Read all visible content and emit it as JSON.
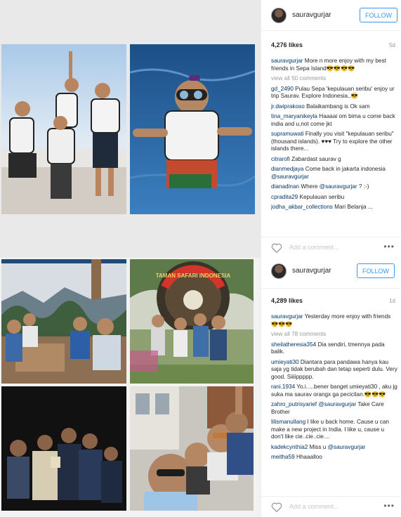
{
  "post1": {
    "username": "sauravgurjar",
    "follow_label": "FOLLOW",
    "likes": "4,276 likes",
    "age": "5d",
    "caption_user": "sauravgurjar",
    "caption_text": "More n more enjoy with my best friends in Sepa Island😎😎😎😎",
    "view_all": "view all 50 comments",
    "comments": [
      {
        "user": "gd_2490",
        "text": "Pulau Sepa 'kepulauan seribu' enjoy ur trip Saurav. Explore Indonesia..😎"
      },
      {
        "user": "jr.dwiprakoso",
        "text": "Balaikambang is Ok sam"
      },
      {
        "user": "tina_maryanikeyla",
        "text": "Haaaai om bima u come back india and u,not come jkt"
      },
      {
        "user": "supramuwati",
        "text": "Finally you visit \"kepulauan seribu\" (thousand islands). ♥♥♥ Try to explore the other islands there..."
      },
      {
        "user": "citrarofi",
        "text": "Zabardast saurav g"
      },
      {
        "user": "dianmedjaya",
        "text": "Come back in jakarta indonesia",
        "mention": "@sauravgurjar"
      },
      {
        "user": "dianadinan",
        "text": "Where",
        "mention": "@sauravgurjar",
        "suffix": "? :-)"
      },
      {
        "user": "cpradita29",
        "text": "Kepulauan seribu"
      },
      {
        "user": "jodha_akbar_collections",
        "text": "Mari Belanja ..."
      }
    ],
    "add_comment_placeholder": "Add a comment...",
    "more_label": "•••"
  },
  "post2": {
    "username": "sauravgurjar",
    "follow_label": "FOLLOW",
    "likes": "4,289 likes",
    "age": "1d",
    "caption_user": "sauravgurjar",
    "caption_text": "Yesterday more enjoy with friends 😎😎😎",
    "view_all": "view all 78 comments",
    "comments": [
      {
        "user": "sheilatheresia354",
        "text": "Dia sendiri, tmennya pada balik."
      },
      {
        "user": "umieyati30",
        "text": "Diantara para pandawa hanya kau saja yg tidak berubah dan tetap seperti dulu. Very good. Siiiippppp."
      },
      {
        "user": "rani.1934",
        "text": "Yo.i.....bener banget umieyati30 , aku jg suka ma saurav orangx ga pecicilan.😎😎😎"
      },
      {
        "user": "zahro_putrisyarief",
        "text": "Take Care Brother",
        "mention": "@sauravgurjar"
      },
      {
        "user": "lilismanullang",
        "text": "I like u back home. Cause u can make a new project in India. I like u, cause u don't like cie..cie..cie...."
      },
      {
        "user": "kadekcynthia2",
        "text": "Miss u",
        "mention": "@sauravgurjar"
      },
      {
        "user": "meitha59",
        "text": "Hhaaalloo"
      }
    ],
    "add_comment_placeholder": "Add a comment...",
    "more_label": "•••",
    "sign_text": "TAMAN SAFARI INDONESIA"
  },
  "colors": {
    "link": "#003569",
    "follow": "#3897f0",
    "muted": "#999999"
  }
}
